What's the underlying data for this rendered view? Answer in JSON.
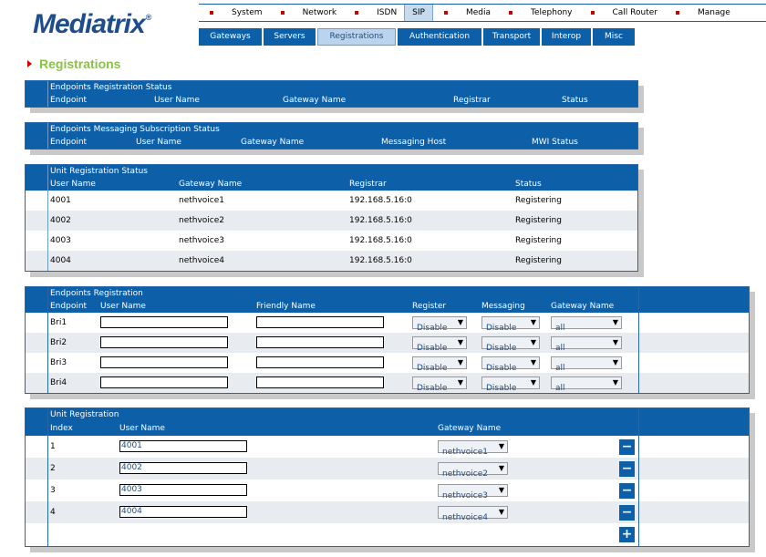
{
  "brand": {
    "name": "Mediatrix",
    "reg": "®"
  },
  "topnav": [
    "System",
    "Network",
    "ISDN",
    "SIP",
    "Media",
    "Telephony",
    "Call Router",
    "Manage"
  ],
  "subnav": [
    "Gateways",
    "Servers",
    "Registrations",
    "Authentication",
    "Transport",
    "Interop",
    "Misc"
  ],
  "page_title": "Registrations",
  "ep_status": {
    "title": "Endpoints Registration Status",
    "headers": [
      "Endpoint",
      "User Name",
      "Gateway Name",
      "Registrar",
      "Status"
    ]
  },
  "msg_status": {
    "title": "Endpoints Messaging Subscription Status",
    "headers": [
      "Endpoint",
      "User Name",
      "Gateway Name",
      "Messaging Host",
      "MWI Status"
    ]
  },
  "unit_status": {
    "title": "Unit Registration Status",
    "headers": [
      "User Name",
      "Gateway Name",
      "Registrar",
      "Status"
    ],
    "rows": [
      [
        "4001",
        "nethvoice1",
        "192.168.5.16:0",
        "Registering"
      ],
      [
        "4002",
        "nethvoice2",
        "192.168.5.16:0",
        "Registering"
      ],
      [
        "4003",
        "nethvoice3",
        "192.168.5.16:0",
        "Registering"
      ],
      [
        "4004",
        "nethvoice4",
        "192.168.5.16:0",
        "Registering"
      ]
    ]
  },
  "ep_reg": {
    "title": "Endpoints Registration",
    "headers": [
      "Endpoint",
      "User Name",
      "Friendly Name",
      "Register",
      "Messaging",
      "Gateway Name"
    ],
    "rows": [
      {
        "endpoint": "Bri1",
        "user": "",
        "friendly": "",
        "register": "Disable",
        "messaging": "Disable",
        "gateway": "all"
      },
      {
        "endpoint": "Bri2",
        "user": "",
        "friendly": "",
        "register": "Disable",
        "messaging": "Disable",
        "gateway": "all"
      },
      {
        "endpoint": "Bri3",
        "user": "",
        "friendly": "",
        "register": "Disable",
        "messaging": "Disable",
        "gateway": "all"
      },
      {
        "endpoint": "Bri4",
        "user": "",
        "friendly": "",
        "register": "Disable",
        "messaging": "Disable",
        "gateway": "all"
      }
    ]
  },
  "unit_reg": {
    "title": "Unit Registration",
    "headers": [
      "Index",
      "User Name",
      "Gateway Name"
    ],
    "rows": [
      {
        "index": "1",
        "user": "4001",
        "gateway": "nethvoice1"
      },
      {
        "index": "2",
        "user": "4002",
        "gateway": "nethvoice2"
      },
      {
        "index": "3",
        "user": "4003",
        "gateway": "nethvoice3"
      },
      {
        "index": "4",
        "user": "4004",
        "gateway": "nethvoice4"
      }
    ]
  },
  "icons": {
    "remove": "−",
    "add": "+",
    "dropdown": "▼"
  },
  "colors": {
    "brand": "#1d4d8c",
    "header": "#0d5fa8",
    "title": "#8dc049",
    "bullet": "#cc0000"
  }
}
